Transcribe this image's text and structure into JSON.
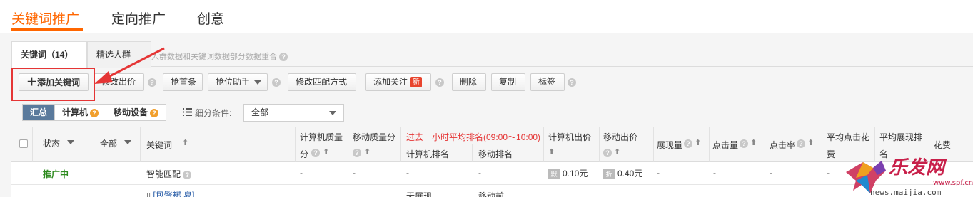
{
  "top_tabs": [
    "关键词推广",
    "定向推广",
    "创意"
  ],
  "sub_tabs": [
    "关键词（14）",
    "精选人群"
  ],
  "sub_tab_note": "人群数据和关键词数据部分数据重合",
  "toolbar": {
    "add_keyword": "添加关键词",
    "modify_bid": "修改出价",
    "grab_top": "抢首条",
    "rank_helper": "抢位助手",
    "modify_match": "修改匹配方式",
    "add_follow": "添加关注",
    "new_badge": "新",
    "delete": "删除",
    "copy": "复制",
    "tag": "标签"
  },
  "segments": [
    "汇总",
    "计算机",
    "移动设备"
  ],
  "filter": {
    "label": "细分条件:",
    "selected": "全部"
  },
  "table": {
    "headers": {
      "status": "状态",
      "all": "全部",
      "keyword": "关键词",
      "pc_quality_1": "计算机质量",
      "pc_quality_2": "分",
      "mobile_quality": "移动质量分",
      "rank_group": "过去一小时平均排名(09:00～10:00)",
      "pc_rank": "计算机排名",
      "mobile_rank": "移动排名",
      "pc_bid": "计算机出价",
      "mobile_bid": "移动出价",
      "impressions": "展现量",
      "clicks": "点击量",
      "ctr": "点击率",
      "avg_cpc_1": "平均点击花",
      "avg_cpc_2": "费",
      "avg_rank_1": "平均展现排",
      "avg_rank_2": "名",
      "cost": "花费"
    },
    "rows": [
      {
        "status": "推广中",
        "keyword": "智能匹配",
        "pc_quality": "-",
        "mobile_quality": "-",
        "pc_rank": "-",
        "mobile_rank": "-",
        "pc_bid_icon": "默",
        "pc_bid": "0.10元",
        "mobile_bid_icon": "折",
        "mobile_bid": "0.40元",
        "impressions": "-",
        "clicks": "-",
        "ctr": "-",
        "avg_cpc": "-"
      },
      {
        "keyword": "[包臀裙 夏]",
        "pc_rank": "无展现",
        "mobile_rank": "移动前三"
      }
    ]
  },
  "watermark": {
    "text": "乐发网",
    "url": "news.maijia.com",
    "url2": "www.spf.cn"
  },
  "colors": {
    "accent": "#ff6600",
    "highlight_red": "#e53535",
    "active_segment": "#5a7a9c",
    "status_green": "#2e8b1f"
  }
}
